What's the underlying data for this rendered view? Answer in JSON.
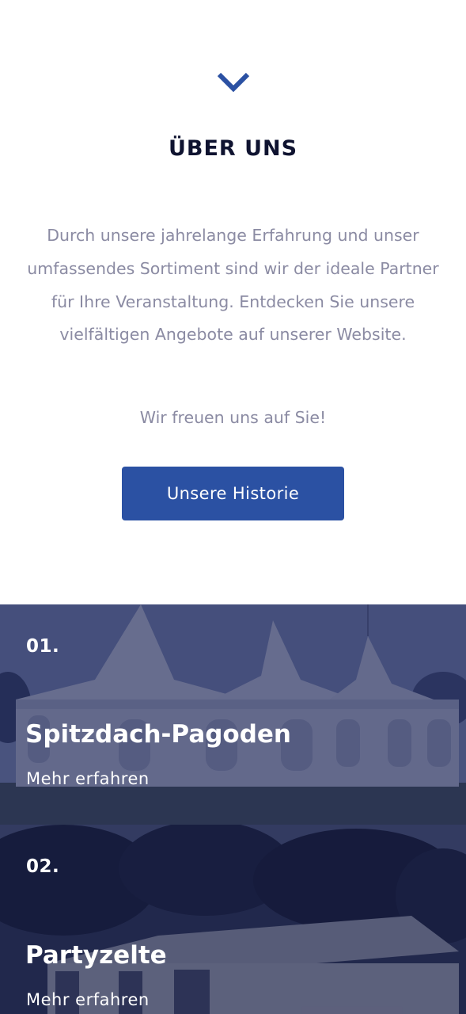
{
  "colors": {
    "accent": "#2b51a3",
    "heading": "#0f1330",
    "body_text": "#8b8ba3",
    "card_overlay": "#182052"
  },
  "scroll_indicator": {
    "icon": "chevron-down-icon"
  },
  "about": {
    "heading": "ÜBER UNS",
    "text": "Durch unsere jahrelange Erfahrung und unser umfassendes Sortiment sind wir der ideale Partner für Ihre Veranstaltung. Entdecken Sie unsere vielfältigen Angebote auf unserer Website.",
    "greeting": "Wir freuen uns auf Sie!",
    "button_label": "Unsere Historie"
  },
  "products": [
    {
      "number": "01.",
      "title": "Spitzdach-Pagoden",
      "link": "Mehr erfahren"
    },
    {
      "number": "02.",
      "title": "Partyzelte",
      "link": "Mehr erfahren"
    }
  ]
}
